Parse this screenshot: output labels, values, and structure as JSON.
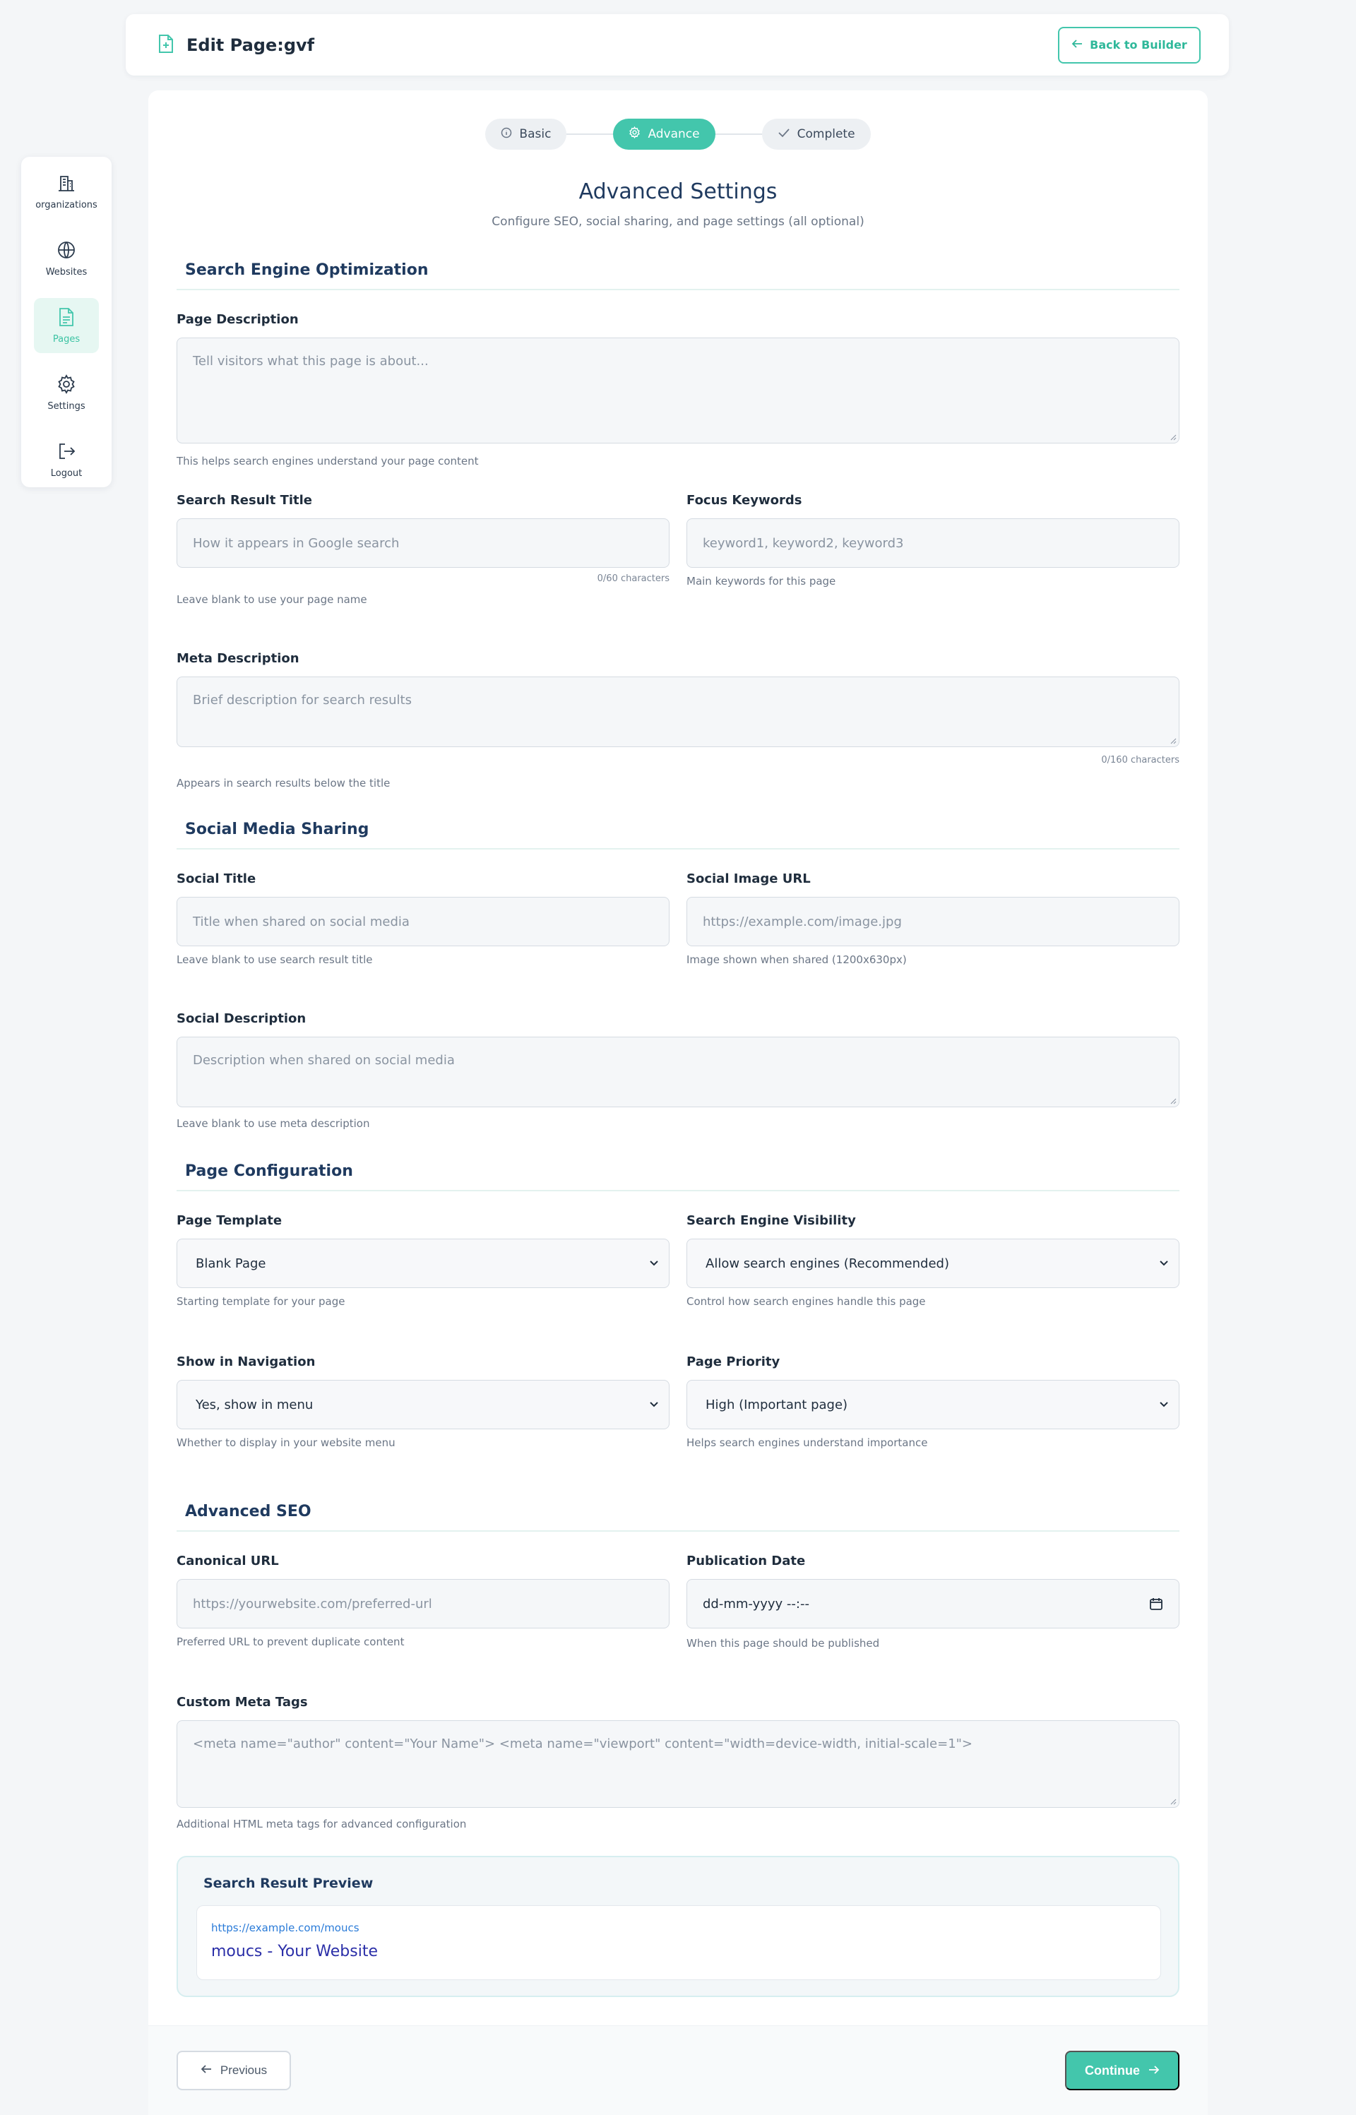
{
  "header": {
    "title": "Edit Page:gvf",
    "back_label": "Back to Builder"
  },
  "sidebar": {
    "items": [
      {
        "label": "organizations",
        "icon": "building-icon"
      },
      {
        "label": "Websites",
        "icon": "globe-icon"
      },
      {
        "label": "Pages",
        "icon": "document-icon",
        "active": true
      },
      {
        "label": "Settings",
        "icon": "gear-icon"
      },
      {
        "label": "Logout",
        "icon": "logout-icon"
      }
    ]
  },
  "stepper": {
    "steps": [
      {
        "label": "Basic",
        "icon": "info-icon"
      },
      {
        "label": "Advance",
        "icon": "gear-icon",
        "active": true
      },
      {
        "label": "Complete",
        "icon": "check-icon"
      }
    ]
  },
  "page": {
    "title": "Advanced Settings",
    "subtitle": "Configure SEO, social sharing, and page settings (all optional)"
  },
  "seo": {
    "heading": "Search Engine Optimization",
    "page_description": {
      "label": "Page Description",
      "placeholder": "Tell visitors what this page is about...",
      "hint": "This helps search engines understand your page content"
    },
    "search_title": {
      "label": "Search Result Title",
      "placeholder": "How it appears in Google search",
      "counter": "0/60 characters",
      "hint": "Leave blank to use your page name"
    },
    "focus_keywords": {
      "label": "Focus Keywords",
      "placeholder": "keyword1, keyword2, keyword3",
      "hint": "Main keywords for this page"
    },
    "meta_description": {
      "label": "Meta Description",
      "placeholder": "Brief description for search results",
      "counter": "0/160 characters",
      "hint": "Appears in search results below the title"
    }
  },
  "social": {
    "heading": "Social Media Sharing",
    "title": {
      "label": "Social Title",
      "placeholder": "Title when shared on social media",
      "hint": "Leave blank to use search result title"
    },
    "image_url": {
      "label": "Social Image URL",
      "placeholder": "https://example.com/image.jpg",
      "hint": "Image shown when shared (1200x630px)"
    },
    "description": {
      "label": "Social Description",
      "placeholder": "Description when shared on social media",
      "hint": "Leave blank to use meta description"
    }
  },
  "config": {
    "heading": "Page Configuration",
    "template": {
      "label": "Page Template",
      "value": "Blank Page",
      "hint": "Starting template for your page"
    },
    "visibility": {
      "label": "Search Engine Visibility",
      "value": "Allow search engines (Recommended)",
      "hint": "Control how search engines handle this page"
    },
    "navigation": {
      "label": "Show in Navigation",
      "value": "Yes, show in menu",
      "hint": "Whether to display in your website menu"
    },
    "priority": {
      "label": "Page Priority",
      "value": "High (Important page)",
      "hint": "Helps search engines understand importance"
    }
  },
  "advanced": {
    "heading": "Advanced SEO",
    "canonical": {
      "label": "Canonical URL",
      "placeholder": "https://yourwebsite.com/preferred-url",
      "hint": "Preferred URL to prevent duplicate content"
    },
    "publication": {
      "label": "Publication Date",
      "value": "dd-mm-yyyy --:--",
      "hint": "When this page should be published"
    },
    "custom_meta": {
      "label": "Custom Meta Tags",
      "placeholder": "<meta name=\"author\" content=\"Your Name\"> <meta name=\"viewport\" content=\"width=device-width, initial-scale=1\">",
      "hint": "Additional HTML meta tags for advanced configuration"
    }
  },
  "preview": {
    "title": "Search Result Preview",
    "url": "https://example.com/moucs",
    "link": "moucs - Your Website"
  },
  "footer": {
    "previous_label": "Previous",
    "continue_label": "Continue"
  },
  "colors": {
    "accent": "#43c6ac",
    "heading": "#1f3a5f",
    "background": "#f4f6f8"
  }
}
